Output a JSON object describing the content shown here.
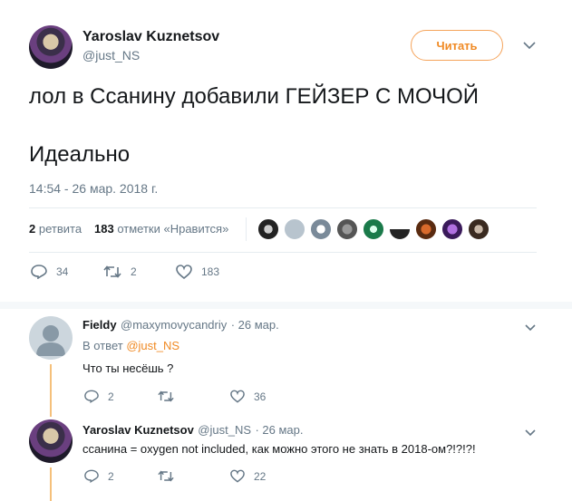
{
  "tweet": {
    "author_name": "Yaroslav Kuznetsov",
    "author_handle": "@just_NS",
    "follow_label": "Читать",
    "text_line1": "лол в Ссанину добавили ГЕЙЗЕР С МОЧОЙ",
    "text_line2": "Идеально",
    "timestamp": "14:54 - 26 мар. 2018 г.",
    "retweets_count": "2",
    "retweets_label": "ретвита",
    "likes_count": "183",
    "likes_label": "отметки «Нравится»",
    "actions": {
      "replies": "34",
      "retweets": "2",
      "likes": "183"
    }
  },
  "replies": [
    {
      "name": "Fieldy",
      "handle": "@maxymovycandriy",
      "time": "· 26 мар.",
      "in_reply_prefix": "В ответ",
      "in_reply_handle": "@just_NS",
      "text": "Что ты несёшь ?",
      "actions": {
        "replies": "2",
        "retweets": "",
        "likes": "36"
      }
    },
    {
      "name": "Yaroslav Kuznetsov",
      "handle": "@just_NS",
      "time": "· 26 мар.",
      "text": "ссанина = oxygen not included, как можно этого не знать в 2018-ом?!?!?!",
      "actions": {
        "replies": "2",
        "retweets": "",
        "likes": "22"
      }
    }
  ],
  "colors": {
    "accent": "#f08a24",
    "muted": "#657786",
    "thread": "#f5c07b"
  }
}
